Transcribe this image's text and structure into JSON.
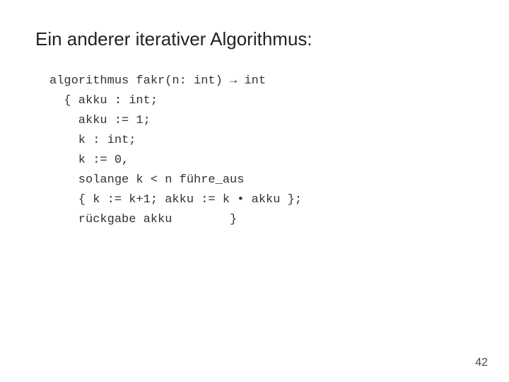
{
  "slide": {
    "title": "Ein anderer iterativer Algorithmus:",
    "code": {
      "line1": "algorithmus fakr(n: int) → int",
      "line2": "  { akku : int;",
      "line3": "    akku := 1;",
      "line4": "    k : int;",
      "line5": "    k := 0,",
      "line6": "    solange k < n führe_aus",
      "line7": "    { k := k+1; akku := k • akku };",
      "line8": "    rückgabe akku        }"
    },
    "page_number": "42"
  }
}
